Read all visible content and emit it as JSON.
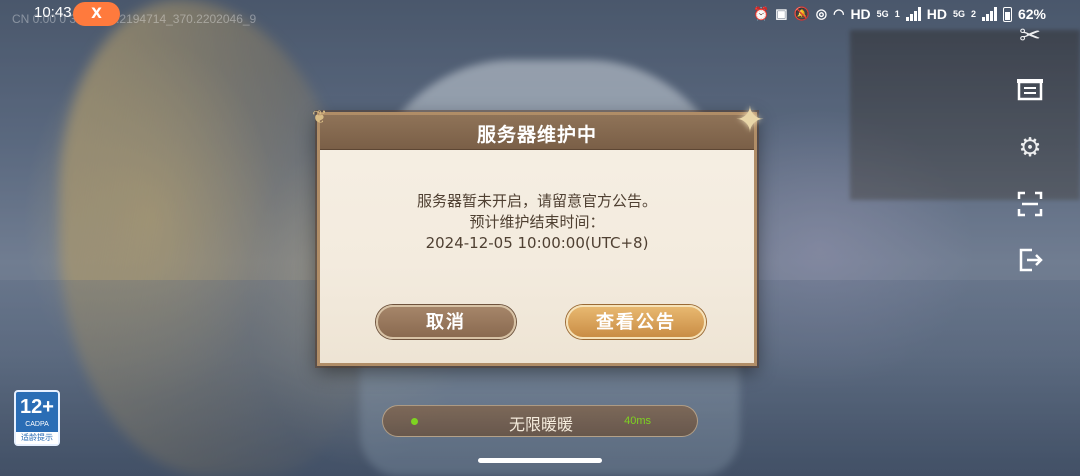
{
  "status_bar": {
    "time": "10:43",
    "app_badge": "X",
    "debug_text": "CN 0.00 0 370_364.2194714_370.2202046_9",
    "network_1": "HD",
    "network_1_gen": "5G",
    "network_1_sim": "1",
    "network_2": "HD",
    "network_2_gen": "5G",
    "network_2_sim": "2",
    "battery": "62%"
  },
  "toolbar": {
    "icons": [
      "tools-icon",
      "notice-board-icon",
      "gear-icon",
      "scan-icon",
      "exit-icon"
    ]
  },
  "dialog": {
    "title": "服务器维护中",
    "line1": "服务器暂未开启，请留意官方公告。",
    "line2": "预计维护结束时间：",
    "line3": "2024-12-05 10:00:00(UTC+8)",
    "cancel_label": "取消",
    "notice_label": "查看公告"
  },
  "server": {
    "name": "无限暖暖",
    "ping": "40ms",
    "status_color": "#7ed321"
  },
  "age_rating": {
    "number": "12+",
    "org": "CADPA",
    "label": "适龄提示"
  },
  "colors": {
    "dialog_header": "#7a5f47",
    "cancel_button": "#8a6a50",
    "notice_button": "#c98d45",
    "app_badge": "#ff7a3d"
  }
}
